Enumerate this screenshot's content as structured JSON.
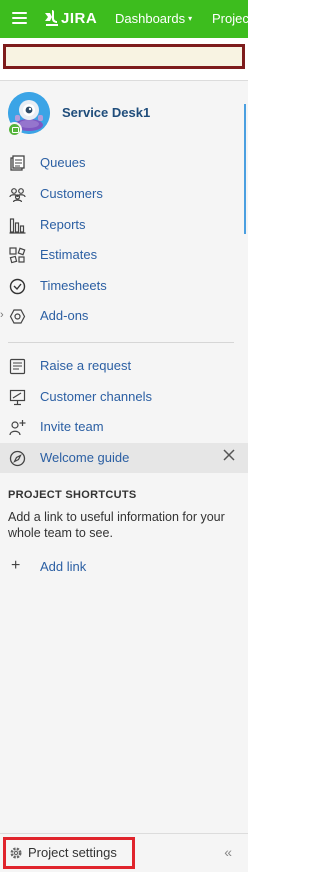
{
  "topbar": {
    "logo_text": "JIRA",
    "dashboards_label": "Dashboards",
    "projects_label": "Projec",
    "caret": "▾"
  },
  "project": {
    "name": "Service Desk1"
  },
  "nav": {
    "items": [
      {
        "label": "Queues",
        "icon": "queues-icon"
      },
      {
        "label": "Customers",
        "icon": "customers-icon"
      },
      {
        "label": "Reports",
        "icon": "reports-icon"
      },
      {
        "label": "Estimates",
        "icon": "estimates-icon"
      },
      {
        "label": "Timesheets",
        "icon": "timesheets-icon"
      },
      {
        "label": "Add-ons",
        "icon": "addons-icon"
      }
    ],
    "actions": [
      {
        "label": "Raise a request",
        "icon": "raise-request-icon"
      },
      {
        "label": "Customer channels",
        "icon": "customer-channels-icon"
      },
      {
        "label": "Invite team",
        "icon": "invite-team-icon"
      },
      {
        "label": "Welcome guide",
        "icon": "compass-icon"
      }
    ]
  },
  "shortcuts": {
    "title": "PROJECT SHORTCUTS",
    "description": "Add a link to useful information for your whole team to see.",
    "add_link_label": "Add link",
    "plus": "+"
  },
  "footer": {
    "settings_label": "Project settings",
    "collapse_label": "«"
  },
  "colors": {
    "topbar": "#3dbd1e",
    "link": "#2b5fa3",
    "highlight_border": "#e0242c",
    "banner_border": "#7e1c1c"
  }
}
